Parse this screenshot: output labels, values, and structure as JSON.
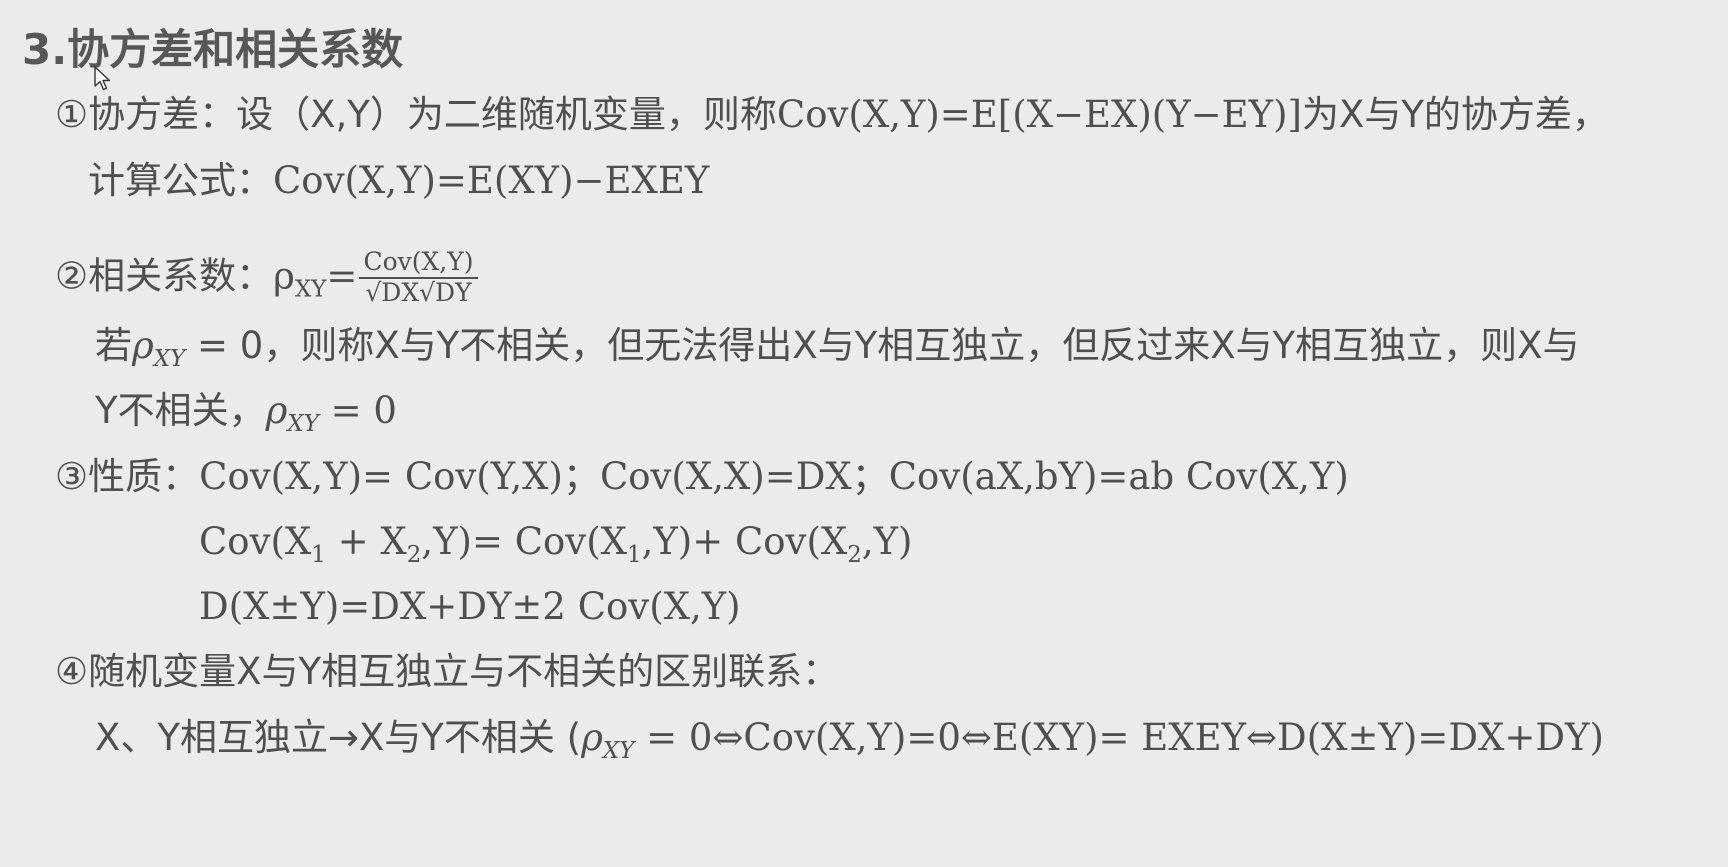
{
  "title": "3.协方差和相关系数",
  "s1": {
    "marker": "①",
    "label": "协方差：设（X,Y）为二维随机变量，则称",
    "formula": "Cov(X,Y)=E[(X−EX)(Y−EY)]",
    "tail": "为X与Y的协方差，",
    "l2_label": "计算公式：",
    "l2_formula": "Cov(X,Y)=E(XY)−EXEY"
  },
  "s2": {
    "marker": "②",
    "label": "相关系数：",
    "rho": "ρ",
    "rho_sub": "XY",
    "eq": "=",
    "num": "Cov(X,Y)",
    "den": "√DX√DY",
    "l2_a": "若",
    "l2_rho": "ρ",
    "l2_sub": "XY",
    "l2_b": " = 0，则称X与Y不相关，但无法得出X与Y相互独立，但反过来X与Y相互独立，则X与",
    "l3_a": "Y不相关，",
    "l3_rho": "ρ",
    "l3_sub": "XY",
    "l3_b": " = 0"
  },
  "s3": {
    "marker": "③",
    "label": "性质：",
    "l1": "Cov(X,Y)= Cov(Y,X)；Cov(X,X)=DX；Cov(aX,bY)=ab Cov(X,Y)",
    "l2_a": "Cov(X",
    "l2_s1": "1",
    "l2_b": " + X",
    "l2_s2": "2",
    "l2_c": ",Y)= Cov(X",
    "l2_s3": "1",
    "l2_d": ",Y)+ Cov(X",
    "l2_s4": "2",
    "l2_e": ",Y)",
    "l3": "D(X±Y)=DX+DY±2 Cov(X,Y)"
  },
  "s4": {
    "marker": "④",
    "label": "随机变量X与Y相互独立与不相关的区别联系：",
    "l2_a": "X、Y相互独立→X与Y不相关 (",
    "l2_rho": "ρ",
    "l2_sub": "XY",
    "l2_b": " = 0⇔Cov(X,Y)=0⇔E(XY)= EXEY⇔D(X±Y)=DX+DY)"
  },
  "colors": {
    "background": "#ebebeb",
    "text": "#4f4f4f",
    "title": "#575757"
  },
  "icons": {
    "cursor": "mouse-pointer-icon"
  }
}
